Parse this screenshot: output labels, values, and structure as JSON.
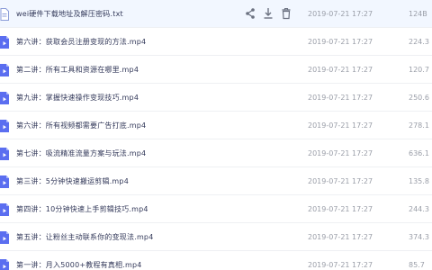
{
  "files": [
    {
      "name": "wei硬件下载地址及解压密码.txt",
      "date": "2019-07-21 17:27",
      "size": "124B",
      "type": "txt"
    },
    {
      "name": "第六讲：获取会员注册变现的方法.mp4",
      "date": "2019-07-21 17:27",
      "size": "224.3",
      "type": "video"
    },
    {
      "name": "第二讲：所有工具和资源在哪里.mp4",
      "date": "2019-07-21 17:27",
      "size": "120.7",
      "type": "video"
    },
    {
      "name": "第九讲：掌握快速操作变现技巧.mp4",
      "date": "2019-07-21 17:27",
      "size": "250.6",
      "type": "video"
    },
    {
      "name": "第六讲：所有视频都需要广告打底.mp4",
      "date": "2019-07-21 17:27",
      "size": "278.1",
      "type": "video"
    },
    {
      "name": "第七讲：吸流精准流量方案与玩法.mp4",
      "date": "2019-07-21 17:27",
      "size": "636.1",
      "type": "video"
    },
    {
      "name": "第三讲：5分钟快速搬运剪辑.mp4",
      "date": "2019-07-21 17:27",
      "size": "135.8",
      "type": "video"
    },
    {
      "name": "第四讲：10分钟快速上手剪辑技巧.mp4",
      "date": "2019-07-21 17:27",
      "size": "244.3",
      "type": "video"
    },
    {
      "name": "第五讲：让粉丝主动联系你的变现法.mp4",
      "date": "2019-07-21 17:27",
      "size": "374.3",
      "type": "video"
    },
    {
      "name": "第一讲：月入5000+教程有真相.mp4",
      "date": "2019-07-21 17:27",
      "size": "85.7",
      "type": "video"
    }
  ],
  "actions": [
    "share-icon",
    "download-icon",
    "delete-icon"
  ],
  "colors": {
    "accent": "#3b7cff",
    "icon_blue": "#4a6cf7",
    "hover_bg": "#f2f7ff"
  }
}
